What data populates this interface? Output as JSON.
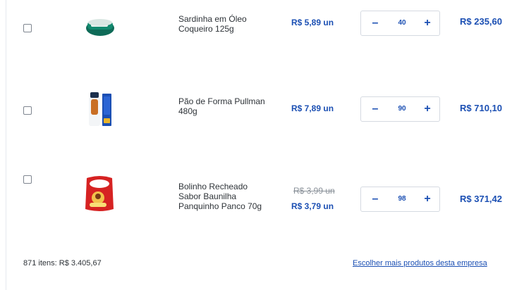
{
  "cart": {
    "items": [
      {
        "name": "Sardinha em Óleo\nCoqueiro 125g",
        "price": "R$ 5,89 un",
        "old_price": "",
        "quantity": "40",
        "total": "R$ 235,60"
      },
      {
        "name": "Pão de Forma Pullman\n480g",
        "price": "R$ 7,89 un",
        "old_price": "",
        "quantity": "90",
        "total": "R$ 710,10"
      },
      {
        "name": "Bolinho Recheado\nSabor Baunilha\nPanquinho Panco 70g",
        "price": "R$ 3,79 un",
        "old_price": "R$ 3,99 un",
        "quantity": "98",
        "total": "R$ 371,42"
      }
    ],
    "stepper": {
      "minus": "–",
      "plus": "+"
    }
  },
  "footer": {
    "summary": "871 itens: R$ 3.405,67",
    "link": "Escolher mais produtos desta empresa"
  },
  "colors": {
    "accent": "#1b4fb3",
    "text": "#2e3338",
    "muted": "#8a9199",
    "border": "#d5dae1"
  },
  "icons": {
    "minus": "minus-icon",
    "plus": "plus-icon"
  }
}
